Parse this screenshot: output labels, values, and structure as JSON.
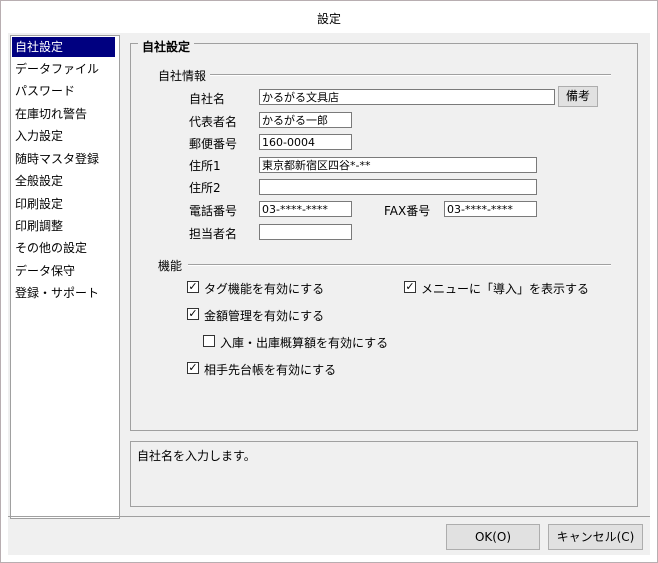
{
  "window": {
    "title": "設定"
  },
  "sidebar": {
    "items": [
      {
        "label": "自社設定",
        "selected": true
      },
      {
        "label": "データファイル"
      },
      {
        "label": "パスワード"
      },
      {
        "label": "在庫切れ警告"
      },
      {
        "label": "入力設定"
      },
      {
        "label": "随時マスタ登録"
      },
      {
        "label": "全般設定"
      },
      {
        "label": "印刷設定"
      },
      {
        "label": "印刷調整"
      },
      {
        "label": "その他の設定"
      },
      {
        "label": "データ保守"
      },
      {
        "label": "登録・サポート"
      }
    ]
  },
  "panel": {
    "title": "自社設定",
    "company_section": {
      "label": "自社情報",
      "company_name": {
        "label": "自社名",
        "value": "かるがる文具店"
      },
      "notes_button": "備考",
      "representative": {
        "label": "代表者名",
        "value": "かるがる一郎"
      },
      "postal_code": {
        "label": "郵便番号",
        "value": "160-0004"
      },
      "address1": {
        "label": "住所1",
        "value": "東京都新宿区四谷*-**"
      },
      "address2": {
        "label": "住所2",
        "value": ""
      },
      "phone": {
        "label": "電話番号",
        "value": "03-****-****"
      },
      "fax": {
        "label": "FAX番号",
        "value": "03-****-****"
      },
      "contact": {
        "label": "担当者名",
        "value": ""
      }
    },
    "features_section": {
      "label": "機能",
      "options": {
        "tag": {
          "label": "タグ機能を有効にする",
          "checked": true
        },
        "menu_intro": {
          "label": "メニューに「導入」を表示する",
          "checked": true
        },
        "amount": {
          "label": "金額管理を有効にする",
          "checked": true
        },
        "inout_amount": {
          "label": "入庫・出庫概算額を有効にする",
          "checked": false
        },
        "partner_ledger": {
          "label": "相手先台帳を有効にする",
          "checked": true
        }
      }
    }
  },
  "description": "自社名を入力します。",
  "footer": {
    "ok_label": "OK(O)",
    "cancel_label": "キャンセル(C)"
  }
}
